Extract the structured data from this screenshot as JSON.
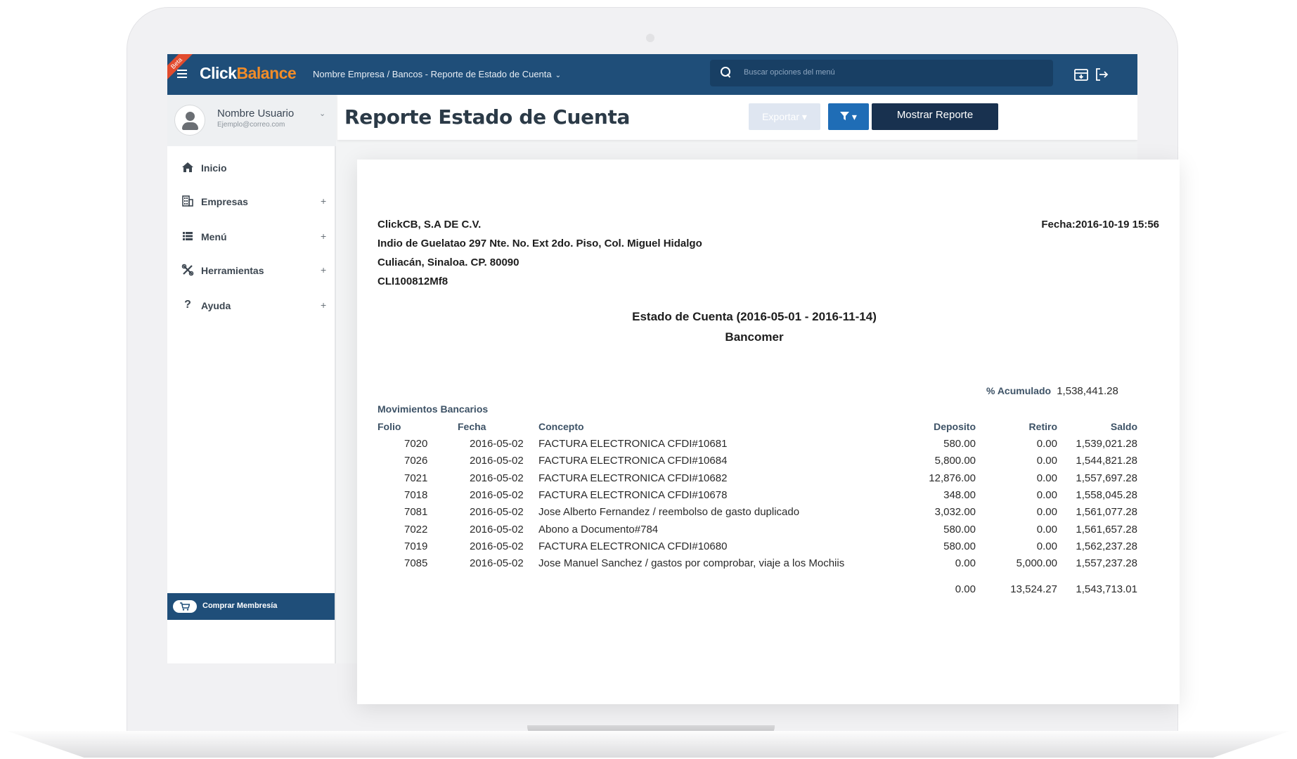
{
  "app": {
    "beta_label": "Beta",
    "logo_click": "Click",
    "logo_balance": "Balance",
    "breadcrumb": "Nombre Empresa / Bancos - Reporte de Estado de Cuenta",
    "search_placeholder": "Buscar opciones del menú"
  },
  "user": {
    "name": "Nombre Usuario",
    "email": "Ejemplo@correo.com"
  },
  "sidebar": {
    "items": [
      {
        "label": "Inicio",
        "icon": "home-icon",
        "expandable": false
      },
      {
        "label": "Empresas",
        "icon": "building-icon",
        "expandable": true
      },
      {
        "label": "Menú",
        "icon": "list-icon",
        "expandable": true
      },
      {
        "label": "Herramientas",
        "icon": "tools-icon",
        "expandable": true
      },
      {
        "label": "Ayuda",
        "icon": "help-icon",
        "expandable": true
      }
    ],
    "expand_symbol": "+",
    "buy_label": "Comprar Membresía"
  },
  "header": {
    "title": "Reporte Estado de Cuenta",
    "export_label": "Exportar ▾",
    "filter_label": "▾",
    "show_report_label": "Mostrar Reporte"
  },
  "report": {
    "company": "ClickCB, S.A DE C.V.",
    "address1": "Indio de Guelatao 297 Nte. No. Ext 2do. Piso, Col. Miguel Hidalgo",
    "address2": "Culiacán, Sinaloa. CP. 80090",
    "rfc": "CLI100812Mf8",
    "fecha": "Fecha:2016-10-19 15:56",
    "title": "Estado de Cuenta (2016-05-01 - 2016-11-14)",
    "bank": "Bancomer",
    "acumulado_label": "% Acumulado",
    "acumulado_value": "1,538,441.28",
    "section_label": "Movimientos Bancarios",
    "columns": {
      "folio": "Folio",
      "fecha": "Fecha",
      "concepto": "Concepto",
      "deposito": "Deposito",
      "retiro": "Retiro",
      "saldo": "Saldo"
    },
    "rows": [
      {
        "folio": "7020",
        "fecha": "2016-05-02",
        "concepto": "FACTURA ELECTRONICA CFDI#10681",
        "deposito": "580.00",
        "retiro": "0.00",
        "saldo": "1,539,021.28"
      },
      {
        "folio": "7026",
        "fecha": "2016-05-02",
        "concepto": "FACTURA ELECTRONICA CFDI#10684",
        "deposito": "5,800.00",
        "retiro": "0.00",
        "saldo": "1,544,821.28"
      },
      {
        "folio": "7021",
        "fecha": "2016-05-02",
        "concepto": "FACTURA ELECTRONICA CFDI#10682",
        "deposito": "12,876.00",
        "retiro": "0.00",
        "saldo": "1,557,697.28"
      },
      {
        "folio": "7018",
        "fecha": "2016-05-02",
        "concepto": "FACTURA ELECTRONICA CFDI#10678",
        "deposito": "348.00",
        "retiro": "0.00",
        "saldo": "1,558,045.28"
      },
      {
        "folio": "7081",
        "fecha": "2016-05-02",
        "concepto": "Jose Alberto Fernandez / reembolso de gasto duplicado",
        "deposito": "3,032.00",
        "retiro": "0.00",
        "saldo": "1,561,077.28"
      },
      {
        "folio": "7022",
        "fecha": "2016-05-02",
        "concepto": "Abono a Documento#784",
        "deposito": "580.00",
        "retiro": "0.00",
        "saldo": "1,561,657.28"
      },
      {
        "folio": "7019",
        "fecha": "2016-05-02",
        "concepto": "FACTURA ELECTRONICA CFDI#10680",
        "deposito": "580.00",
        "retiro": "0.00",
        "saldo": "1,562,237.28"
      },
      {
        "folio": "7085",
        "fecha": "2016-05-02",
        "concepto": "Jose Manuel Sanchez / gastos por comprobar, viaje a los Mochiis",
        "deposito": "0.00",
        "retiro": "5,000.00",
        "saldo": "1,557,237.28"
      }
    ],
    "totals": {
      "deposito": "0.00",
      "retiro": "13,524.27",
      "saldo": "1,543,713.01"
    }
  },
  "colors": {
    "topbar": "#1f4e79",
    "accent_orange": "#f28c28",
    "primary_button": "#18314f",
    "filter_button": "#1f6db6"
  }
}
